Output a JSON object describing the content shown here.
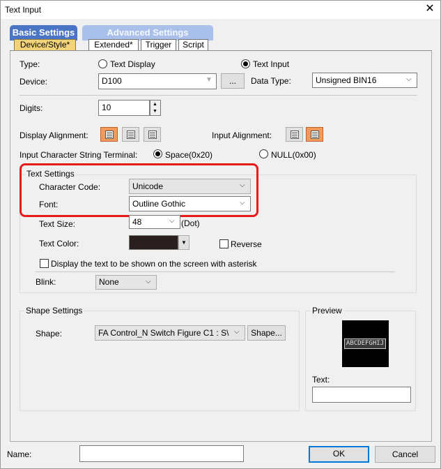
{
  "window": {
    "title": "Text Input",
    "close": "✕"
  },
  "tabs": {
    "basic": "Basic Settings",
    "advanced": "Advanced Settings",
    "sub": [
      "Device/Style*",
      "Extended*",
      "Trigger",
      "Script"
    ]
  },
  "type": {
    "label": "Type:",
    "option_display": "Text Display",
    "option_input": "Text Input",
    "selected": "Text Input"
  },
  "device": {
    "label": "Device:",
    "value": "D100",
    "browse": "..."
  },
  "data_type": {
    "label": "Data Type:",
    "value": "Unsigned BIN16"
  },
  "digits": {
    "label": "Digits:",
    "value": "10"
  },
  "display_alignment": {
    "label": "Display Alignment:",
    "selected": "left"
  },
  "input_alignment": {
    "label": "Input Alignment:",
    "selected": "right"
  },
  "terminal": {
    "label": "Input Character String Terminal:",
    "option_space": "Space(0x20)",
    "option_null": "NULL(0x00)",
    "selected": "Space(0x20)"
  },
  "text_settings": {
    "title": "Text Settings",
    "character_code_label": "Character Code:",
    "character_code": "Unicode",
    "font_label": "Font:",
    "font": "Outline Gothic",
    "size_label": "Text Size:",
    "size": "48",
    "size_unit": "(Dot)",
    "color_label": "Text Color:",
    "text_color": "#2a1e1e",
    "reverse_label": "Reverse",
    "reverse_checked": false,
    "asterisk_label": "Display the text to be shown on the screen with asterisk",
    "asterisk_checked": false,
    "blink_label": "Blink:",
    "blink": "None"
  },
  "shape_settings": {
    "title": "Shape Settings",
    "shape_label": "Shape:",
    "shape": "FA Control_N Switch Figure C1 : S\\",
    "shape_button": "Shape..."
  },
  "preview": {
    "title": "Preview",
    "sample": "ABCDEFGHIJ",
    "text_label": "Text:",
    "text_value": ""
  },
  "footer": {
    "name_label": "Name:",
    "name_value": "",
    "ok": "OK",
    "cancel": "Cancel"
  },
  "colors": {
    "highlight": "#e81a1a",
    "tab_active": "#4a74c4",
    "tab_inactive": "#a9c0ea",
    "subtab_active": "#f3d37a",
    "align_selected": "#f29a5c",
    "ok_border": "#0078d7"
  },
  "icons": {
    "chevron": "chevron-down-icon",
    "spin_up": "spin-up-icon",
    "spin_down": "spin-down-icon"
  }
}
